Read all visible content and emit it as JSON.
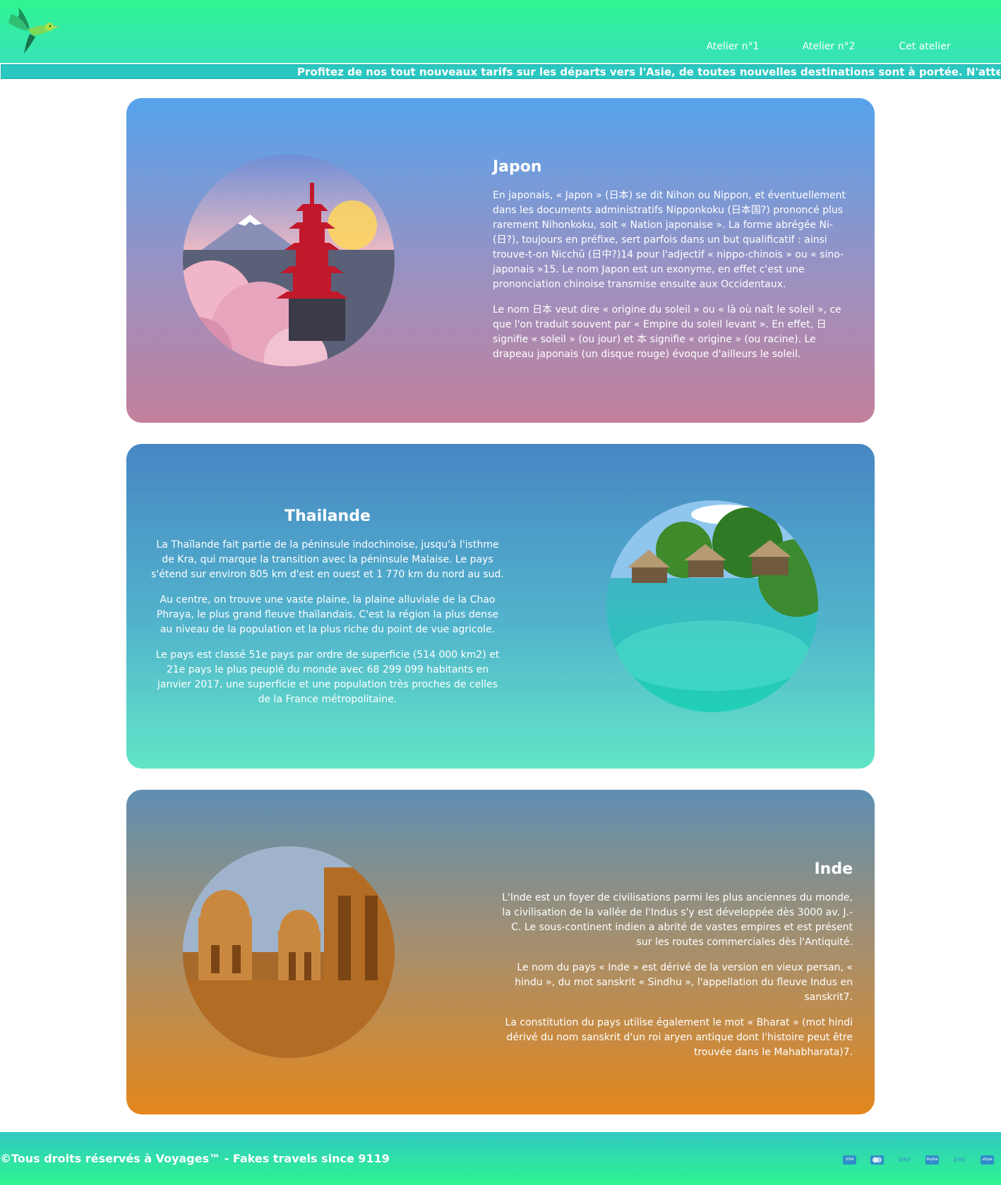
{
  "nav": {
    "items": [
      "Atelier n°1",
      "Atelier n°2",
      "Cet atelier"
    ]
  },
  "ticker": {
    "text": "Profitez de nos tout nouveaux tarifs sur les départs vers l'Asie, de toutes nouvelles destinations sont à portée. N'attendez pas que le"
  },
  "cards": {
    "japon": {
      "title": "Japon",
      "paragraphs": [
        "En japonais, « Japon » (日本) se dit Nihon ou Nippon, et éventuellement dans les documents administratifs Nipponkoku (日本国?) prononcé plus rarement Nihonkoku, soit « Nation japonaise ». La forme abrégée Ni- (日?), toujours en préfixe, sert parfois dans un but qualificatif : ainsi trouve-t-on Nicchū (日中?)14 pour l'adjectif « nippo-chinois » ou « sino-japonais »15. Le nom Japon est un exonyme, en effet c'est une prononciation chinoise transmise ensuite aux Occidentaux.",
        "Le nom 日本 veut dire « origine du soleil » ou « là où naît le soleil », ce que l'on traduit souvent par « Empire du soleil levant ». En effet, 日 signifie « soleil » (ou jour) et 本 signifie « origine » (ou racine). Le drapeau japonais (un disque rouge) évoque d'ailleurs le soleil."
      ]
    },
    "thailande": {
      "title": "Thailande",
      "paragraphs": [
        "La Thaïlande fait partie de la péninsule indochinoise, jusqu'à l'isthme de Kra, qui marque la transition avec la péninsule Malaise. Le pays s'étend sur environ 805 km d'est en ouest et 1 770 km du nord au sud.",
        "Au centre, on trouve une vaste plaine, la plaine alluviale de la Chao Phraya, le plus grand fleuve thaïlandais. C'est la région la plus dense au niveau de la population et la plus riche du point de vue agricole.",
        "Le pays est classé 51e pays par ordre de superficie (514 000 km2) et 21e pays le plus peuplé du monde avec 68 299 099 habitants en janvier 2017, une superficie et une population très proches de celles de la France métropolitaine."
      ]
    },
    "inde": {
      "title": "Inde",
      "paragraphs": [
        "L'Inde est un foyer de civilisations parmi les plus anciennes du monde, la civilisation de la vallée de l'Indus s'y est développée dès 3000 av. J.-C. Le sous-continent indien a abrité de vastes empires et est présent sur les routes commerciales dès l'Antiquité.",
        "Le nom du pays « Inde » est dérivé de la version en vieux persan, « hindu », du mot sanskrit « Sindhu », l'appellation du fleuve Indus en sanskrit7.",
        "La constitution du pays utilise également le mot « Bharat » (mot hindi dérivé du nom sanskrit d'un roi aryen antique dont l'histoire peut être trouvée dans le Mahabharata)7."
      ]
    }
  },
  "footer": {
    "copyright": "©Tous droits réservés à Voyages™ - Fakes travels since 9119",
    "payment_icons": [
      "visa-icon",
      "mastercard-icon",
      "amazon-pay-icon",
      "paypal-icon",
      "apple-pay-icon",
      "stripe-icon"
    ],
    "payment_labels": [
      "VISA",
      "",
      "pay",
      "PayPal",
      "pay",
      "stripe"
    ]
  },
  "colors": {
    "header_top": "#2ef591",
    "ticker_bg": "#2ac6c0",
    "japan_card_top": "#56a3ec",
    "japan_card_bottom": "#c3809b",
    "thai_card_top": "#4787c4",
    "thai_card_bottom": "#62e5c6",
    "inde_card_top": "#5f8fb3",
    "inde_card_bottom": "#e4871d"
  }
}
